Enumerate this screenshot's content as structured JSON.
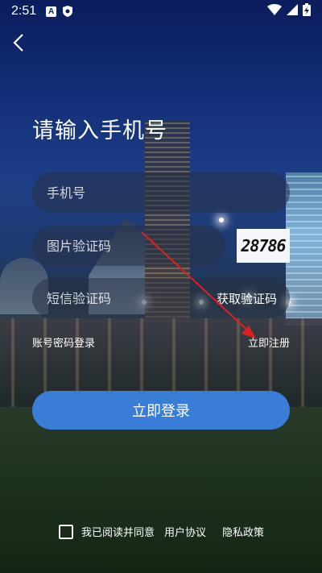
{
  "status_bar": {
    "time": "2:51",
    "icons": [
      "a-notification-icon",
      "shield-icon",
      "wifi-icon",
      "signal-icon",
      "battery-charging-icon"
    ]
  },
  "nav": {
    "back_icon": "back-chevron-icon"
  },
  "title": "请输入手机号",
  "form": {
    "phone_placeholder": "手机号",
    "captcha_placeholder": "图片验证码",
    "captcha_code": "28786",
    "sms_placeholder": "短信验证码",
    "get_code_label": "获取验证码"
  },
  "links": {
    "password_login": "账号密码登录",
    "register": "立即注册"
  },
  "login_button": "立即登录",
  "agreement": {
    "prefix": "我已阅读并同意",
    "user_agreement": "用户协议",
    "privacy_policy": "隐私政策"
  },
  "colors": {
    "primary_button": "#3a7dd6",
    "annotation_arrow": "#e02020"
  }
}
